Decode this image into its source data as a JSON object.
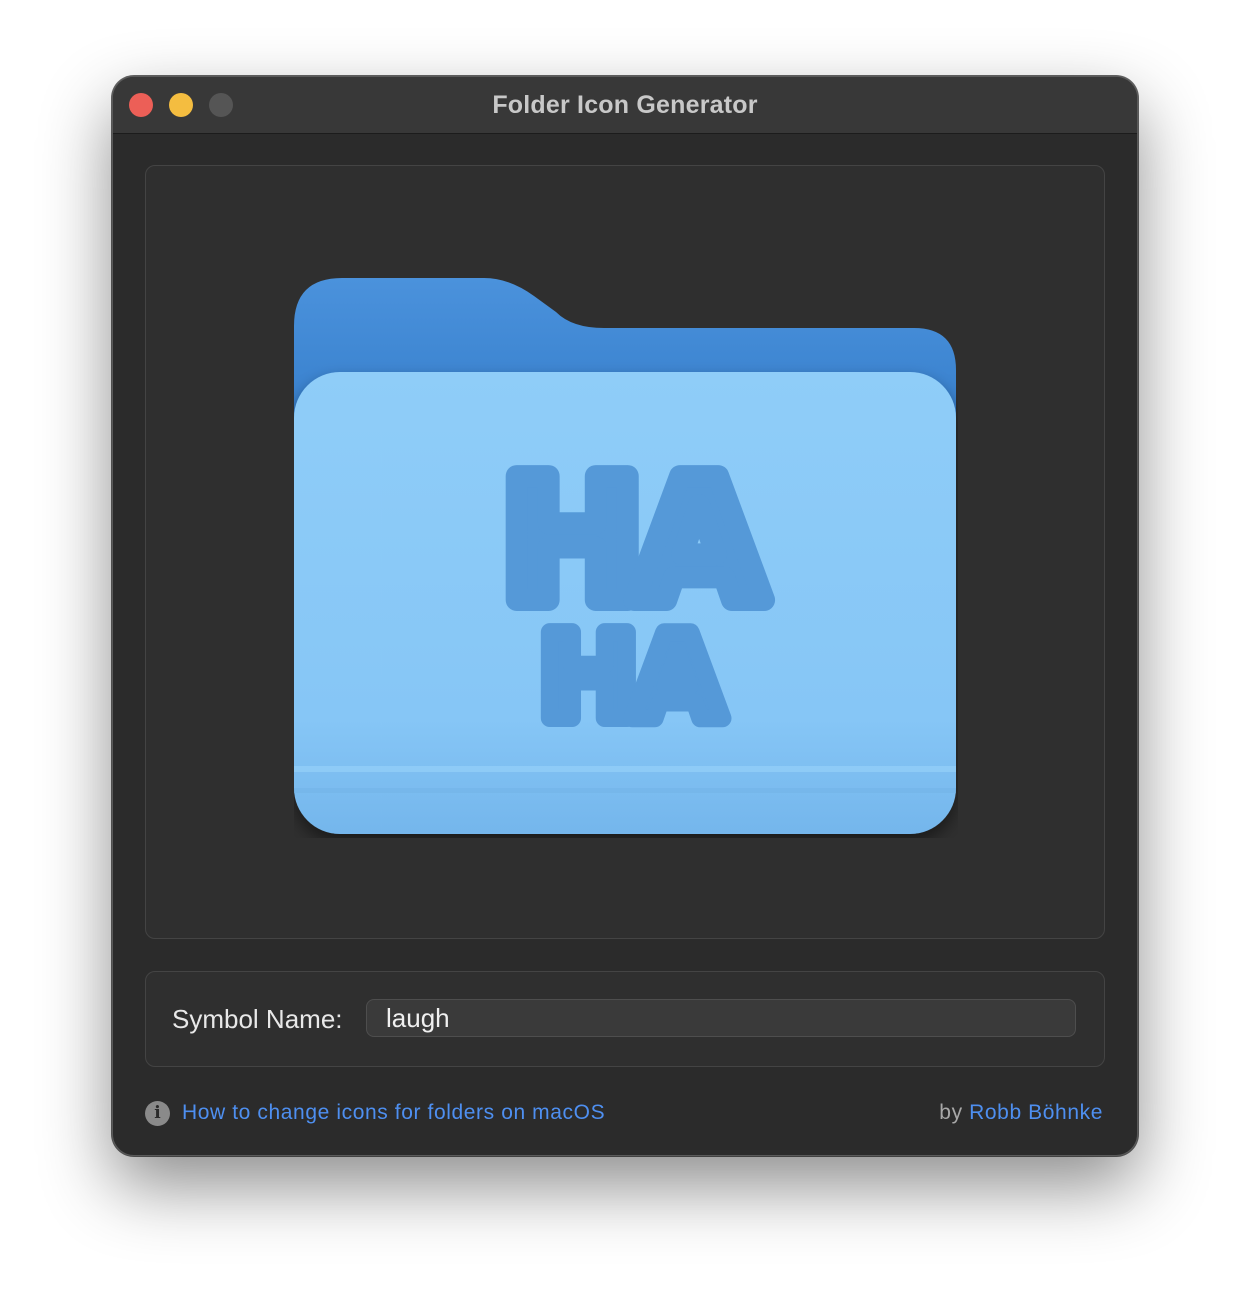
{
  "window": {
    "title": "Folder Icon Generator"
  },
  "preview": {
    "symbol_glyph_lines": [
      "HA",
      "HA"
    ],
    "folder_colors": {
      "back": "#3f89d6",
      "front": "#86c6f6",
      "symbol": "#5599d8"
    }
  },
  "form": {
    "symbol_label": "Symbol Name:",
    "symbol_value": "laugh"
  },
  "footer": {
    "info_icon": "info-circle-icon",
    "help_link": "How to change icons for folders on macOS",
    "by_text": "by",
    "author": "Robb Böhnke"
  },
  "colors": {
    "window_bg": "#2b2b2b",
    "titlebar_bg": "#383838",
    "link": "#4e8ff0",
    "close": "#ec5f57",
    "minimize": "#f4bd40",
    "zoom_inactive": "#555555"
  }
}
